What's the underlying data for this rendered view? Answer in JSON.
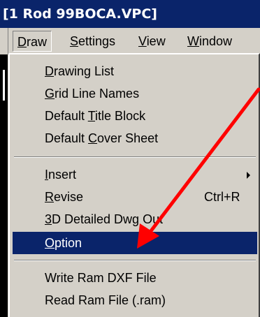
{
  "window": {
    "title": "[1 Rod 99BOCA.VPC]"
  },
  "menubar": {
    "items": [
      {
        "pre": "",
        "key": "D",
        "post": "raw"
      },
      {
        "pre": "",
        "key": "S",
        "post": "ettings"
      },
      {
        "pre": "",
        "key": "V",
        "post": "iew"
      },
      {
        "pre": "",
        "key": "W",
        "post": "indow"
      }
    ]
  },
  "dropdown": {
    "items": [
      {
        "pre": "",
        "key": "D",
        "post": "rawing List"
      },
      {
        "pre": "",
        "key": "G",
        "post": "rid Line Names"
      },
      {
        "pre": "Default ",
        "key": "T",
        "post": "itle Block"
      },
      {
        "pre": "Default ",
        "key": "C",
        "post": "over Sheet"
      },
      {
        "pre": "",
        "key": "I",
        "post": "nsert"
      },
      {
        "pre": "",
        "key": "R",
        "post": "evise",
        "shortcut": "Ctrl+R"
      },
      {
        "pre": "",
        "key": "3",
        "post": "D Detailed Dwg Out"
      },
      {
        "pre": "",
        "key": "O",
        "post": "ption"
      },
      {
        "pre": "",
        "key": "",
        "post": "Write Ram DXF File"
      },
      {
        "pre": "",
        "key": "",
        "post": "Read Ram File (.ram)"
      }
    ]
  },
  "annotation": {
    "color": "#ff0000"
  },
  "colors": {
    "highlight": "#0a246a",
    "face": "#d4d0c8"
  }
}
